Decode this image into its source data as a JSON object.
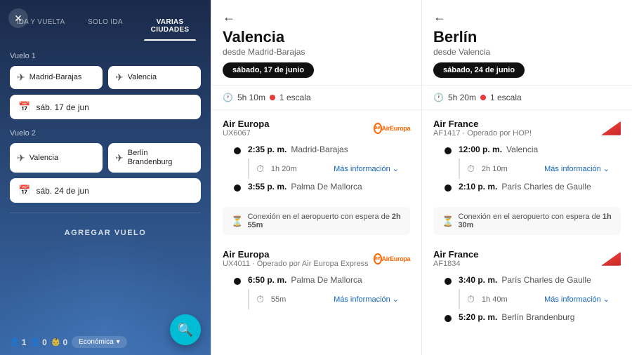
{
  "left": {
    "tabs": [
      {
        "id": "ida-vuelta",
        "label": "IDA Y VUELTA"
      },
      {
        "id": "solo-ida",
        "label": "SOLO IDA"
      },
      {
        "id": "varias-ciudades",
        "label": "VARIAS CIUDADES",
        "active": true
      }
    ],
    "vuelo1": {
      "label": "Vuelo 1",
      "origin": "Madrid-Barajas",
      "destination": "Valencia",
      "date": "sáb. 17 de jun"
    },
    "vuelo2": {
      "label": "Vuelo 2",
      "origin": "Valencia",
      "destination": "Berlín Brandenburg",
      "date": "sáb. 24 de jun"
    },
    "add_flight": "AGREGAR VUELO",
    "passengers": {
      "adults": "1",
      "children": "0",
      "infants": "0"
    },
    "cabin": "Económica"
  },
  "middle": {
    "back": "←",
    "title": "Valencia",
    "subtitle": "desde Madrid-Barajas",
    "date_chip": "sábado, 17 de junio",
    "summary": {
      "duration": "5h 10m",
      "stops": "1 escala"
    },
    "airline1": {
      "name": "Air Europa",
      "code": "UX6067"
    },
    "segment1": {
      "dep_time": "2:35 p. m.",
      "dep_place": "Madrid-Barajas",
      "duration": "1h 20m",
      "more_info": "Más información",
      "arr_time": "3:55 p. m.",
      "arr_place": "Palma De Mallorca"
    },
    "connection1": {
      "text": "Conexión en el aeropuerto con espera de",
      "wait": "2h 55m"
    },
    "airline2": {
      "name": "Air Europa",
      "code": "UX4011 · Operado por Air Europa Express"
    },
    "segment2": {
      "dep_time": "6:50 p. m.",
      "dep_place": "Palma De Mallorca",
      "duration": "55m",
      "more_info": "Más información"
    }
  },
  "right": {
    "back": "←",
    "title": "Berlín",
    "subtitle": "desde Valencia",
    "date_chip": "sábado, 24 de junio",
    "summary": {
      "duration": "5h 20m",
      "stops": "1 escala"
    },
    "airline1": {
      "name": "Air France",
      "code": "AF1417 · Operado por HOP!"
    },
    "segment1": {
      "dep_time": "12:00 p. m.",
      "dep_place": "Valencia",
      "duration": "2h 10m",
      "more_info": "Más información",
      "arr_time": "2:10 p. m.",
      "arr_place": "París Charles de Gaulle"
    },
    "connection1": {
      "text": "Conexión en el aeropuerto con espera de",
      "wait": "1h 30m"
    },
    "airline2": {
      "name": "Air France",
      "code": "AF1834"
    },
    "segment2": {
      "dep_time": "3:40 p. m.",
      "dep_place": "París Charles de Gaulle",
      "duration": "1h 40m",
      "more_info": "Más información",
      "arr_time": "5:20 p. m.",
      "arr_place": "Berlín Brandenburg"
    }
  }
}
